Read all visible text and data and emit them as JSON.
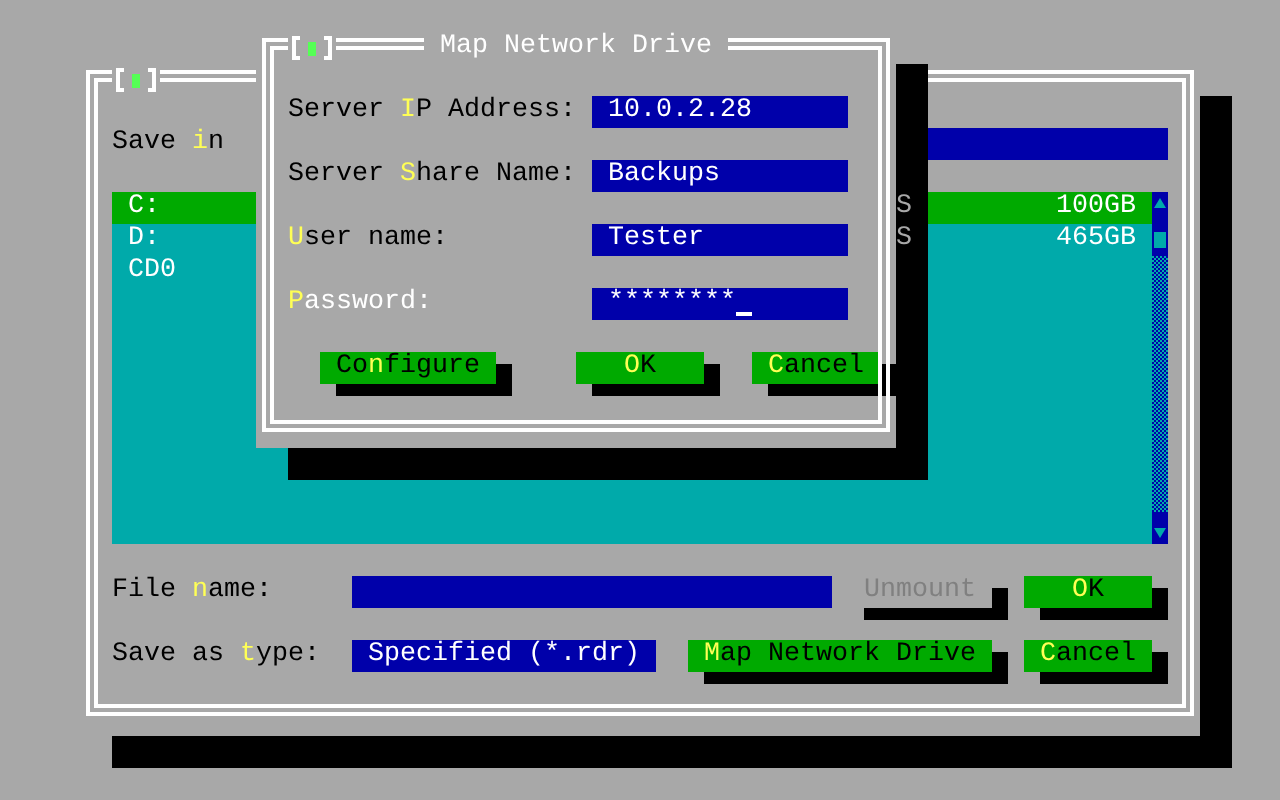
{
  "save_dialog": {
    "save_in": {
      "label": "Save **i**n"
    },
    "drives": [
      {
        "name": "C:",
        "column_2": "S",
        "size": "100GB",
        "selected": true
      },
      {
        "name": "D:",
        "column_2": "S",
        "size": "465GB",
        "selected": false
      },
      {
        "name": "CD0",
        "selected": false
      }
    ],
    "file_name": {
      "label": "File **n**ame:"
    },
    "save_as_type": {
      "label": "Save as **t**ype:",
      "value": "Specified (*.rdr)"
    },
    "buttons": [
      {
        "label": "Unmount",
        "disabled": true
      },
      {
        "label": "**O**K",
        "disabled": false
      },
      {
        "label": "**M**ap Network Drive",
        "disabled": false
      },
      {
        "label": "**C**ancel",
        "disabled": false
      }
    ]
  },
  "map_dialog": {
    "title": "Map Network Drive",
    "fields": [
      {
        "label": "Server **I**P Address:",
        "value": "10.0.2.28",
        "focused": false
      },
      {
        "label": "Server **S**hare Name:",
        "value": "Backups",
        "focused": false
      },
      {
        "label": "**U**ser name:",
        "value": "Tester",
        "focused": false
      },
      {
        "label": "**P**assword:",
        "value": "********",
        "focused": true
      }
    ],
    "buttons": [
      {
        "label": "Co**n**figure",
        "disabled": false
      },
      {
        "label": "**O**K",
        "disabled": false
      },
      {
        "label": "**C**ancel",
        "disabled": false
      }
    ]
  }
}
